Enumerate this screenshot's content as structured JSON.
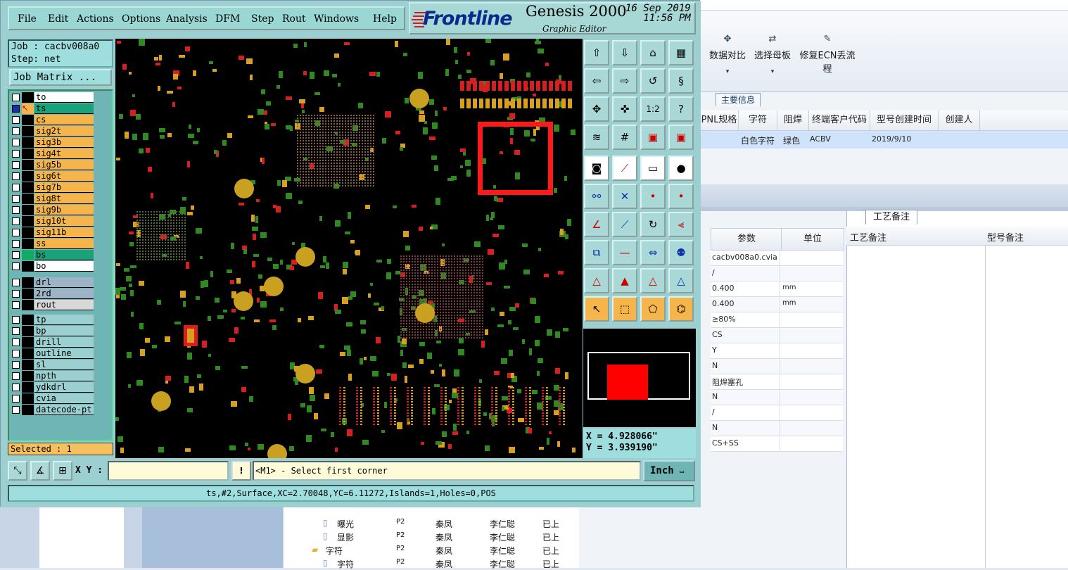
{
  "genesis": {
    "menu": [
      "File",
      "Edit",
      "Actions",
      "Options",
      "Analysis",
      "DFM",
      "Step",
      "Rout",
      "Windows",
      "Help"
    ],
    "brand": {
      "logo": "Frontline",
      "title": "Genesis 2000",
      "subtitle": "Graphic Editor",
      "date": "16 Sep 2019",
      "time": "11:56 PM"
    },
    "job": "Job : cacbv008a0",
    "step": "Step: net",
    "job_matrix_button": "Job Matrix ...",
    "layers_board": [
      {
        "name": "to",
        "color": "#ffffff"
      },
      {
        "name": "ts",
        "color": "#1aa37a",
        "active": true
      },
      {
        "name": "cs",
        "color": "#f5b54a"
      },
      {
        "name": "sig2t",
        "color": "#f5b54a"
      },
      {
        "name": "sig3b",
        "color": "#f5b54a"
      },
      {
        "name": "sig4t",
        "color": "#f5b54a"
      },
      {
        "name": "sig5b",
        "color": "#f5b54a"
      },
      {
        "name": "sig6t",
        "color": "#f5b54a"
      },
      {
        "name": "sig7b",
        "color": "#f5b54a"
      },
      {
        "name": "sig8t",
        "color": "#f5b54a"
      },
      {
        "name": "sig9b",
        "color": "#f5b54a"
      },
      {
        "name": "sig10t",
        "color": "#f5b54a"
      },
      {
        "name": "sig11b",
        "color": "#f5b54a"
      },
      {
        "name": "ss",
        "color": "#f5b54a"
      },
      {
        "name": "bs",
        "color": "#1aa37a"
      },
      {
        "name": "bo",
        "color": "#ffffff"
      }
    ],
    "layers_drill": [
      {
        "name": "drl",
        "color": "#9eb4c6"
      },
      {
        "name": "2rd",
        "color": "#9eb4c6"
      },
      {
        "name": "rout",
        "color": "#d8d8d8"
      }
    ],
    "layers_misc": [
      {
        "name": "tp",
        "color": "#9ccfd0"
      },
      {
        "name": "bp",
        "color": "#9ccfd0"
      },
      {
        "name": "drill",
        "color": "#9ccfd0"
      },
      {
        "name": "outline",
        "color": "#9ccfd0"
      },
      {
        "name": "sl",
        "color": "#9ccfd0"
      },
      {
        "name": "npth",
        "color": "#9ccfd0"
      },
      {
        "name": "ydkdrl",
        "color": "#9ccfd0"
      },
      {
        "name": "cvia",
        "color": "#9ccfd0"
      },
      {
        "name": "datecode-pt",
        "color": "#9ccfd0"
      }
    ],
    "selected": "Selected : 1",
    "coords": {
      "x": "X = 4.928066\"",
      "y": "Y = 3.939190\""
    },
    "xy_label": "X Y :",
    "xy_input": "",
    "prompt": "<M1> - Select first corner",
    "unit": "Inch",
    "status": "ts,#2,Surface,XC=2.70048,YC=6.11272,Islands=1,Holes=0,POS"
  },
  "background_app": {
    "ribbon": [
      {
        "label": "数据对比",
        "icon": "pin-icon"
      },
      {
        "label": "选择母板",
        "icon": "shuffle-icon"
      },
      {
        "label": "修复ECN丢流程",
        "icon": "wrench-icon"
      }
    ],
    "tab": "主要信息",
    "table_headers": [
      "PNL规格",
      "字符",
      "阻焊",
      "终端客户代码",
      "型号创建时间",
      "创建人"
    ],
    "table_row": [
      "白色字符",
      "绿色",
      "ACBV",
      "2019/9/10"
    ],
    "param_headers": [
      "参数",
      "单位"
    ],
    "params": [
      {
        "v": "cacbv008a0.cvia",
        "u": ""
      },
      {
        "v": "/",
        "u": ""
      },
      {
        "v": "0.400",
        "u": "mm"
      },
      {
        "v": "0.400",
        "u": "mm"
      },
      {
        "v": "≥80%",
        "u": ""
      },
      {
        "v": "CS",
        "u": ""
      },
      {
        "v": "Y",
        "u": ""
      },
      {
        "v": "N",
        "u": ""
      },
      {
        "v": "阻焊塞孔",
        "u": ""
      },
      {
        "v": "N",
        "u": ""
      },
      {
        "v": "/",
        "u": ""
      },
      {
        "v": "N",
        "u": ""
      },
      {
        "v": "CS+SS",
        "u": ""
      }
    ],
    "notes_tab": "工艺备注",
    "notes_headers": [
      "工艺备注",
      "型号备注"
    ],
    "tree": [
      {
        "name": "曝光",
        "c1": "P2",
        "c2": "秦凤",
        "c3": "李仁聪",
        "c4": "已上"
      },
      {
        "name": "显影",
        "c1": "P2",
        "c2": "秦凤",
        "c3": "李仁聪",
        "c4": "已上"
      },
      {
        "name": "字符",
        "c1": "P2",
        "c2": "秦凤",
        "c3": "李仁聪",
        "c4": "已上",
        "folder": true
      },
      {
        "name": "字符",
        "c1": "P2",
        "c2": "秦凤",
        "c3": "李仁聪",
        "c4": "已上"
      }
    ]
  }
}
